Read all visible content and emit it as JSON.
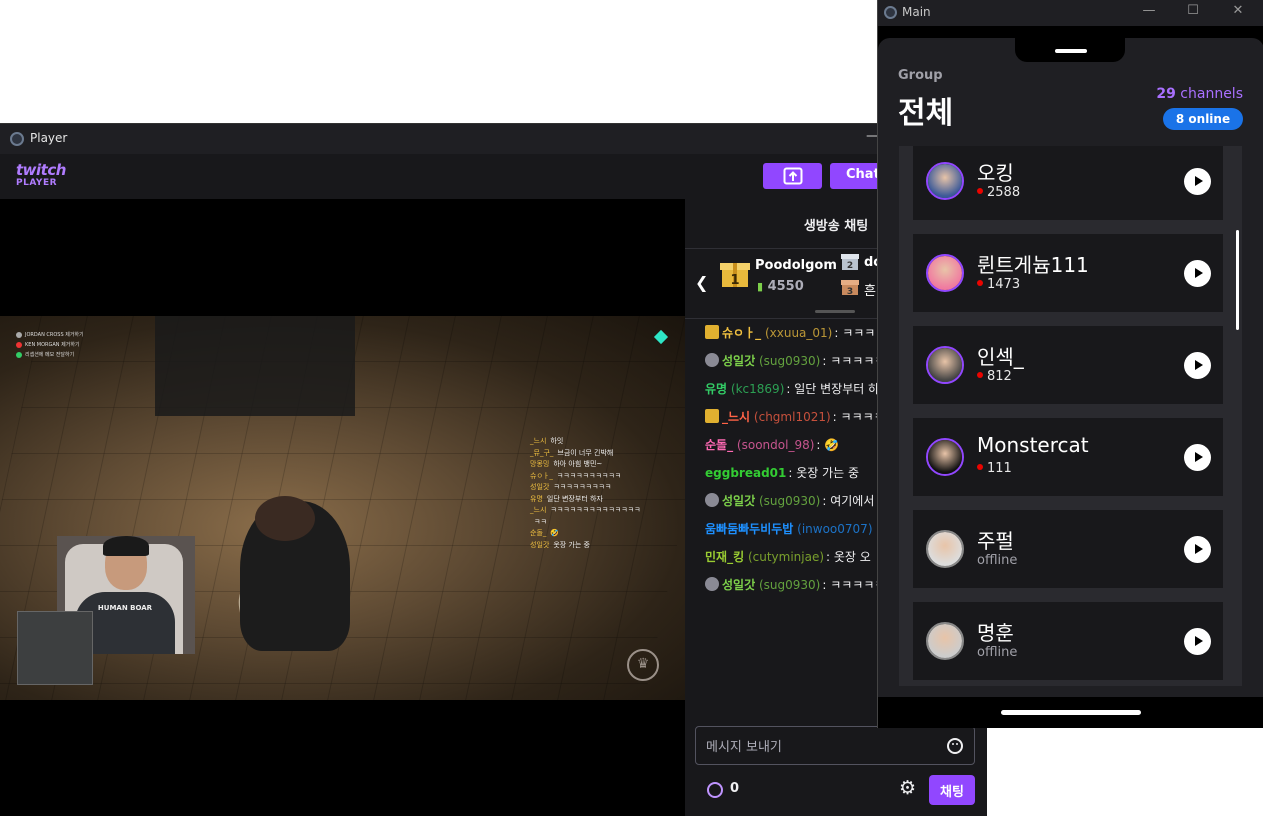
{
  "player_window": {
    "title": "Player",
    "minimize_glyph": "—",
    "logo_line1": "twitch",
    "logo_line2": "PLAYER",
    "chat_button": "Chat",
    "video": {
      "killfeed": [
        "JORDAN CROSS 제거하기",
        "KEN MORGAN 제거하기",
        "리셉션에 메모 전달하기"
      ],
      "overlay_chat": [
        {
          "name": "_느시",
          "text": "하잇"
        },
        {
          "name": "_뮤_구_",
          "text": "브금이 너무 긴박해"
        },
        {
          "name": "망몽밍",
          "text": "하아 아힘 뱅민~"
        },
        {
          "name": "슈ㅇㅏ_",
          "text": "ㅋㅋㅋㅋㅋㅋㅋㅋㅋㅋ"
        },
        {
          "name": "성일갓",
          "text": "ㅋㅋㅋㅋㅋㅋㅋㅋㅋ"
        },
        {
          "name": "유명",
          "text": "일단 변장부터 하자"
        },
        {
          "name": "_느시",
          "text": "ㅋㅋㅋㅋㅋㅋㅋㅋㅋㅋㅋㅋㅋㅋ"
        },
        {
          "name": "",
          "text": "ㅋㅋ"
        },
        {
          "name": "순돌_",
          "text": "🤣"
        },
        {
          "name": "성일갓",
          "text": "옷장 가는 중"
        }
      ],
      "shirt_text": "HUMAN BOAR"
    },
    "chat": {
      "header": "생방송 채팅",
      "gift_top1_name": "Poodolgom",
      "gift_top1_count": "4550",
      "gift_top2_name": "do",
      "gift_top3_name": "흔",
      "messages": [
        {
          "nick": "슈ㅇㅏ_",
          "uid": "(xxuua_01)",
          "text": ": ㅋㅋㅋㅋㅋㅋㅋㅋ",
          "color": "#f0c040",
          "badge": "crown"
        },
        {
          "nick": "성일갓",
          "uid": "(sug0930)",
          "text": ": ㅋㅋㅋㅋㅋㅋㅋ",
          "color": "#7ccf4a",
          "badge": "emblem"
        },
        {
          "nick": "유명",
          "uid": "(kc1869)",
          "text": ": 일단 변장부터 하자",
          "color": "#33cc66",
          "badge": ""
        },
        {
          "nick": "_느시",
          "uid": "(chgml1021)",
          "text": ": ㅋㅋㅋㅋㅋㅋㅋㅋㅋㅋㅋㅋㅋㅋㅋ",
          "color": "#ff6347",
          "badge": "crown2"
        },
        {
          "nick": "순돌_",
          "uid": "(soondol_98)",
          "text": ": 🤣",
          "color": "#ff69b4",
          "badge": ""
        },
        {
          "nick": "eggbread01",
          "uid": "",
          "text": ": 옷장 가는 중",
          "color": "#33cc33",
          "badge": ""
        },
        {
          "nick": "성일갓",
          "uid": "(sug0930)",
          "text": ": 여기에서 옷 갈아입어야 하는 건가 이~",
          "color": "#7ccf4a",
          "badge": "emblem"
        },
        {
          "nick": "움빠둠빠두비두밥",
          "uid": "(inwoo0707)",
          "text": "",
          "color": "#1e90ff",
          "badge": ""
        },
        {
          "nick": "민재_킹",
          "uid": "(cutyminjae)",
          "text": ": 옷장 오",
          "color": "#9acd32",
          "badge": ""
        },
        {
          "nick": "성일갓",
          "uid": "(sug0930)",
          "text": ": ㅋㅋㅋㅋㅋㅋㅋㅋ",
          "color": "#7ccf4a",
          "badge": "emblem"
        }
      ],
      "input_placeholder": "메시지 보내기",
      "points": "0",
      "send_label": "채팅"
    }
  },
  "main_window": {
    "title": "Main",
    "controls": [
      "—",
      "☐",
      "✕"
    ],
    "group_label": "Group",
    "group_title": "전체",
    "channels_count": "29",
    "channels_word": "channels",
    "online_label": "8 online",
    "channels": [
      {
        "name": "오킹",
        "status": "2588",
        "live": true
      },
      {
        "name": "륀트게늄111",
        "status": "1473",
        "live": true
      },
      {
        "name": "인섹_",
        "status": "812",
        "live": true
      },
      {
        "name": "Monstercat",
        "status": "111",
        "live": true
      },
      {
        "name": "주펄",
        "status": "offline",
        "live": false
      },
      {
        "name": "명훈",
        "status": "offline",
        "live": false
      }
    ]
  },
  "colors": {
    "accent_purple": "#9147ff",
    "live_red": "#eb0400",
    "online_blue": "#1a73e8"
  }
}
